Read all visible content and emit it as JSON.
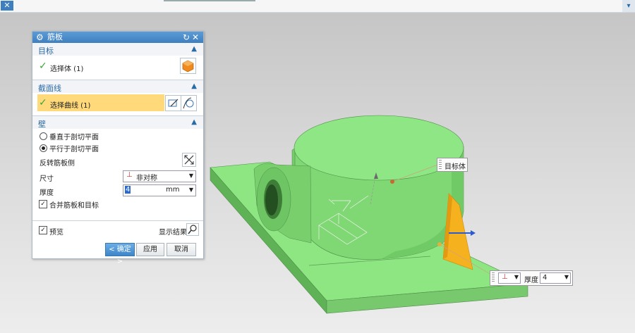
{
  "dialog": {
    "title": "筋板",
    "target": {
      "heading": "目标",
      "select_body": "选择体 (1)"
    },
    "section_line": {
      "heading": "截面线",
      "select_curve": "选择曲线 (1)"
    },
    "wall": {
      "heading": "壁",
      "options": [
        "垂直于剖切平面",
        "平行于剖切平面"
      ],
      "selected_option": 1,
      "flip_label": "反转筋板侧",
      "size_label": "尺寸",
      "size_value": "非对称",
      "thickness_label": "厚度",
      "thickness_value": "4",
      "thickness_unit": "mm",
      "combine_label": "合并筋板和目标",
      "combine_checked": true
    },
    "preview": {
      "label": "预览",
      "checked": true,
      "show_result": "显示结果"
    },
    "buttons": {
      "ok": "< 确定 >",
      "apply": "应用",
      "cancel": "取消"
    }
  },
  "viewport": {
    "callout_target": "目标体",
    "thickness_label": "厚度",
    "thickness_value": "4"
  },
  "colors": {
    "model_green": "#86e07a",
    "rib_orange": "#f6b21e",
    "accent_blue": "#3f7fbf"
  },
  "icons": [
    "settings-gear-icon",
    "reset-icon",
    "close-icon",
    "solid-body-icon",
    "sketch-section-icon",
    "curve-icon",
    "flip-direction-icon",
    "magnifier-icon"
  ]
}
